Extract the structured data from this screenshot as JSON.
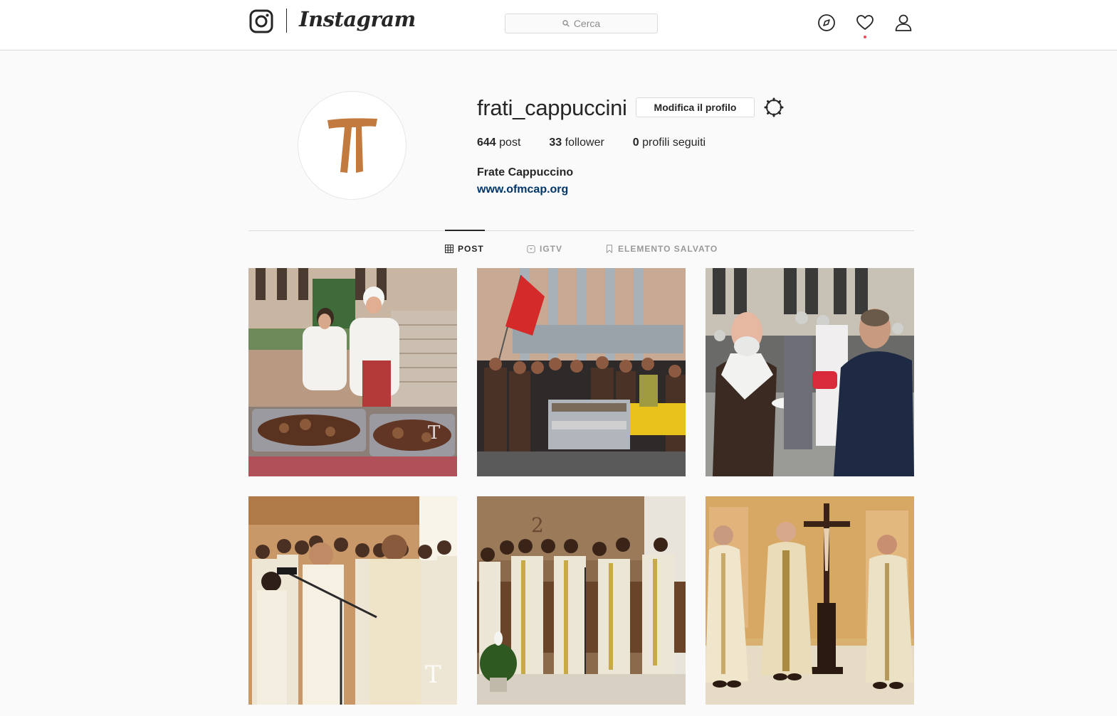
{
  "nav": {
    "logo_text": "Instagram",
    "search_placeholder": "Cerca",
    "icons": [
      "instagram-glyph-icon",
      "search-icon",
      "compass-icon",
      "heart-icon",
      "user-icon"
    ],
    "notification_dot_color": "#ed4956"
  },
  "profile": {
    "username": "frati_cappuccini",
    "edit_button": "Modifica il profilo",
    "stats": {
      "posts_count": "644",
      "posts_label": "post",
      "followers_count": "33",
      "followers_label": "follower",
      "following_count": "0",
      "following_label": "profili seguiti"
    },
    "full_name": "Frate Cappuccino",
    "website": "www.ofmcap.org",
    "avatar_icon": "tau-cross-icon",
    "avatar_color": "#c27a3e"
  },
  "tabs": [
    {
      "label": "POST",
      "icon": "grid-icon",
      "active": true
    },
    {
      "label": "IGTV",
      "icon": "igtv-icon",
      "active": false
    },
    {
      "label": "ELEMENTO SALVATO",
      "icon": "bookmark-icon",
      "active": false
    }
  ],
  "posts": [
    {
      "subject": "kitchen staff with roast meat trays"
    },
    {
      "subject": "group photo with red flag and food cart"
    },
    {
      "subject": "friars chatting outdoors"
    },
    {
      "subject": "friars in white vestments with microphone"
    },
    {
      "subject": "choir of friars in white albs"
    },
    {
      "subject": "priests standing by crucifix"
    }
  ],
  "colors": {
    "link": "#003569",
    "text": "#262626",
    "muted": "#999999",
    "border": "#dbdbdb"
  }
}
